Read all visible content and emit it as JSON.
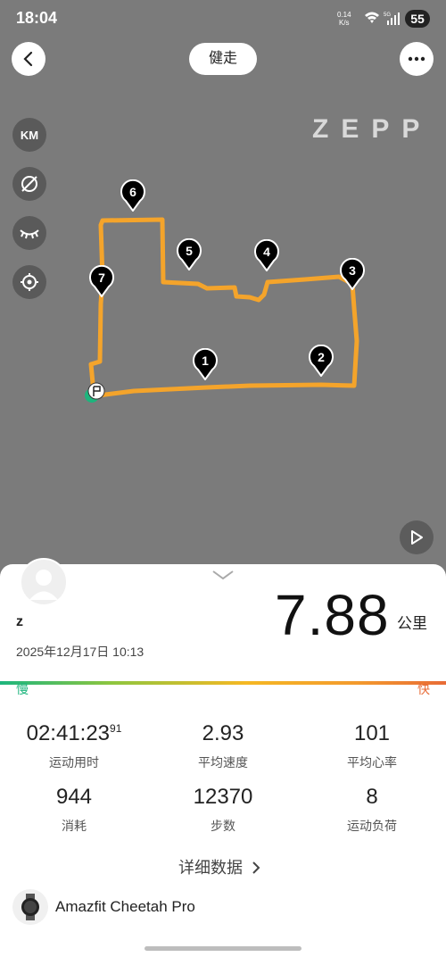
{
  "status": {
    "time": "18:04",
    "net_speed": "0.14",
    "net_unit": "K/s",
    "signal_label": "5G",
    "battery": "55"
  },
  "header": {
    "sport_label": "健走"
  },
  "map": {
    "brand": "ZEPP",
    "tools": {
      "units": "KM"
    },
    "markers": [
      "1",
      "2",
      "3",
      "4",
      "5",
      "6",
      "7"
    ],
    "route_color": "#f4a42b"
  },
  "summary": {
    "user": "z",
    "date": "2025年12月17日 10:13",
    "distance": "7.88",
    "distance_unit": "公里",
    "pace_slow": "慢",
    "pace_fast": "快"
  },
  "stats": [
    {
      "value": "02:41:23",
      "sup": "91",
      "label": "运动用时"
    },
    {
      "value": "2.93",
      "label": "平均速度"
    },
    {
      "value": "101",
      "label": "平均心率"
    },
    {
      "value": "944",
      "label": "消耗"
    },
    {
      "value": "12370",
      "label": "步数"
    },
    {
      "value": "8",
      "label": "运动负荷"
    }
  ],
  "detail_link": "详细数据",
  "device": {
    "name": "Amazfit Cheetah Pro"
  }
}
